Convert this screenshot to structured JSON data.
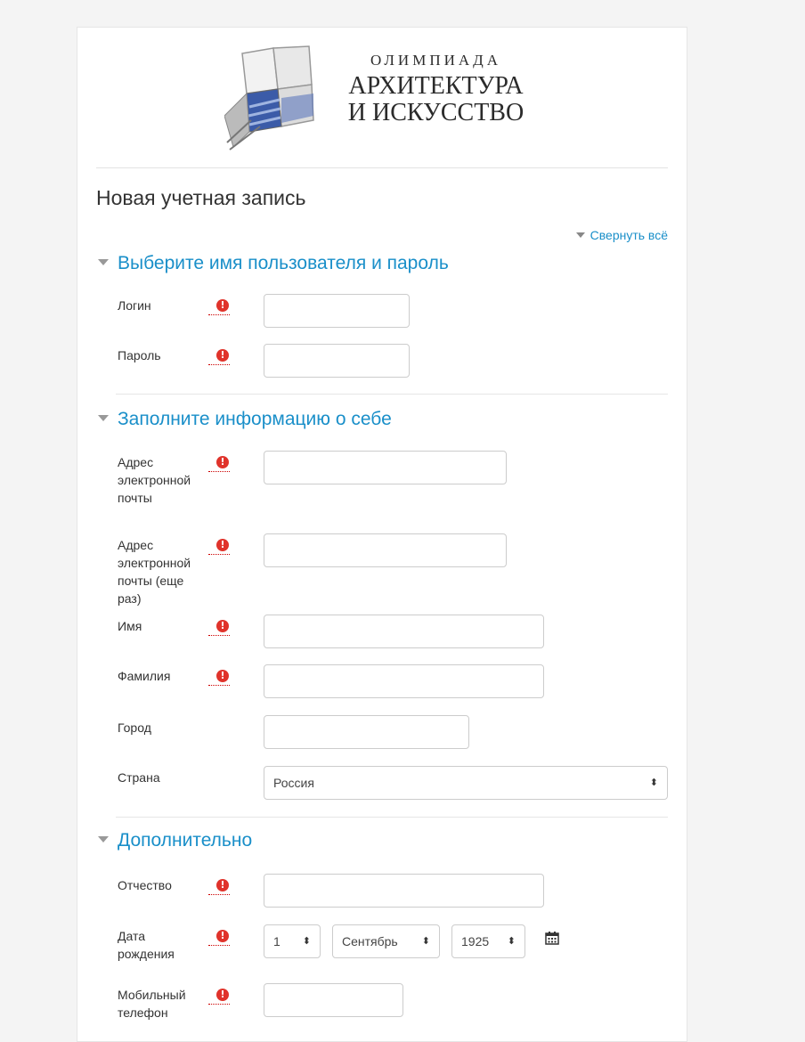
{
  "logo": {
    "line1": "ОЛИМПИАДА",
    "line2": "АРХИТЕКТУРА",
    "line3": "И ИСКУССТВО"
  },
  "page_title": "Новая учетная запись",
  "collapse_all": "Свернуть всё",
  "sections": {
    "account": {
      "title": "Выберите имя пользователя и пароль",
      "login_label": "Логин",
      "password_label": "Пароль"
    },
    "about": {
      "title": "Заполните информацию о себе",
      "email_label": "Адрес электронной почты",
      "email2_label": "Адрес электронной почты (еще раз)",
      "firstname_label": "Имя",
      "lastname_label": "Фамилия",
      "city_label": "Город",
      "country_label": "Страна",
      "country_value": "Россия"
    },
    "extra": {
      "title": "Дополнительно",
      "middlename_label": "Отчество",
      "birthdate_label": "Дата рождения",
      "birth_day": "1",
      "birth_month": "Сентябрь",
      "birth_year": "1925",
      "phone_label": "Мобильный телефон"
    }
  },
  "required_mark": "!",
  "select_arrow": "⬍"
}
